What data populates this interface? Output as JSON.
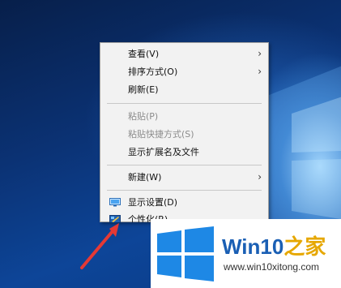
{
  "context_menu": {
    "items": [
      {
        "label": "查看(V)",
        "submenu": true,
        "disabled": false
      },
      {
        "label": "排序方式(O)",
        "submenu": true,
        "disabled": false
      },
      {
        "label": "刷新(E)",
        "submenu": false,
        "disabled": false
      },
      {
        "label": "粘贴(P)",
        "submenu": false,
        "disabled": true
      },
      {
        "label": "粘贴快捷方式(S)",
        "submenu": false,
        "disabled": true
      },
      {
        "label": "显示扩展名及文件",
        "submenu": false,
        "disabled": false
      },
      {
        "label": "新建(W)",
        "submenu": true,
        "disabled": false
      },
      {
        "label": "显示设置(D)",
        "submenu": false,
        "disabled": false,
        "icon": "display-settings-icon"
      },
      {
        "label": "个性化(R)",
        "submenu": false,
        "disabled": false,
        "icon": "personalize-icon"
      }
    ]
  },
  "watermark": {
    "brand_prefix": "Win10",
    "brand_suffix": "之家",
    "url": "www.win10xitong.com"
  },
  "colors": {
    "annotation_arrow": "#e53935",
    "brand_blue": "#1a5fb4",
    "brand_gold": "#e6a700",
    "win_logo_blue": "#1e88e5"
  }
}
